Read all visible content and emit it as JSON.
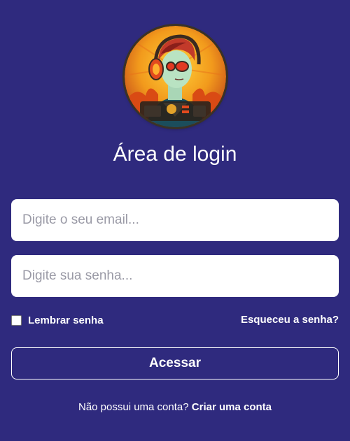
{
  "logo": {
    "icon": "avatar-headphones-icon"
  },
  "header": {
    "title": "Área de login"
  },
  "form": {
    "email_placeholder": "Digite o seu email...",
    "email_value": "",
    "password_placeholder": "Digite sua senha...",
    "password_value": "",
    "remember_label": "Lembrar senha",
    "remember_checked": false,
    "forgot_link": "Esqueceu a senha?",
    "submit_label": "Acessar"
  },
  "footer": {
    "signup_prompt": "Não possui uma conta?",
    "signup_link": "Criar uma conta"
  },
  "colors": {
    "background": "#2f2a7e",
    "text": "#ffffff",
    "input_bg": "#ffffff"
  }
}
